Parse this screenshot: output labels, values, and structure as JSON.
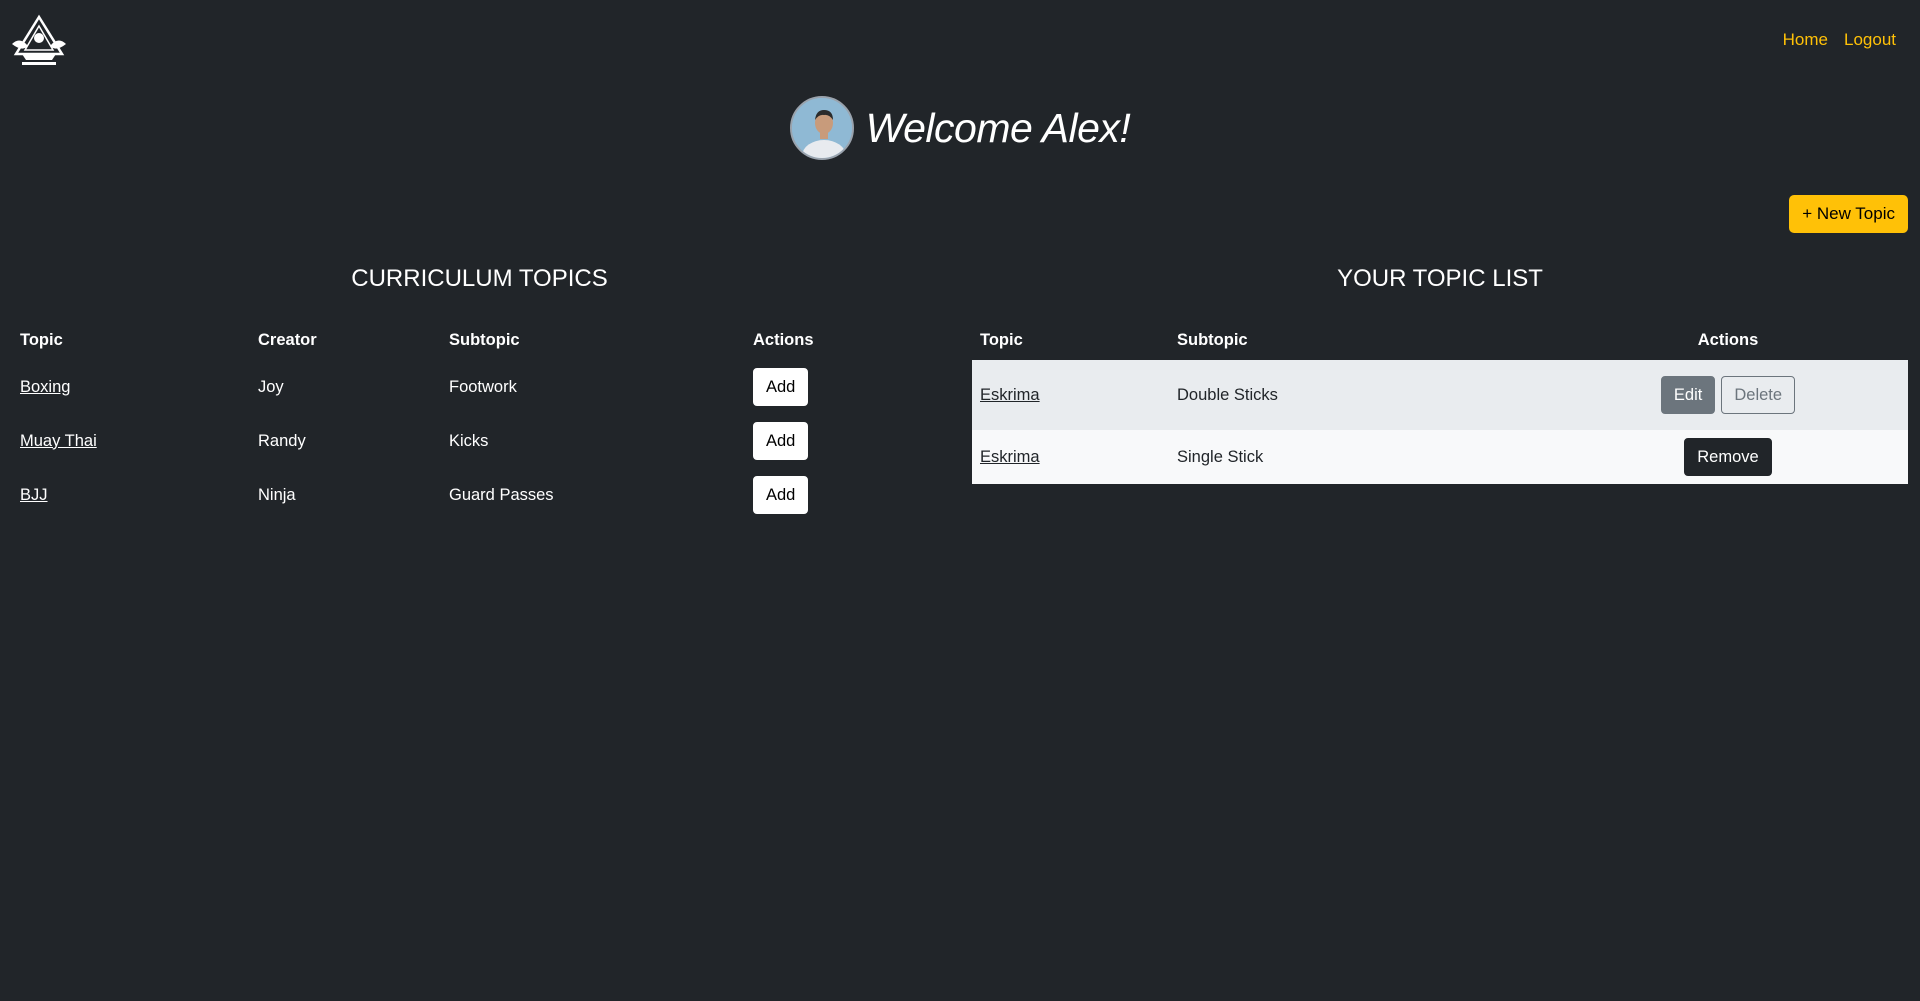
{
  "nav": {
    "home": "Home",
    "logout": "Logout"
  },
  "welcome": {
    "text": "Welcome Alex!"
  },
  "actions": {
    "new_topic": "+ New Topic"
  },
  "curriculum": {
    "title": "CURRICULUM TOPICS",
    "headers": [
      "Topic",
      "Creator",
      "Subtopic",
      "Actions"
    ],
    "rows": [
      {
        "topic": "Boxing",
        "creator": "Joy",
        "subtopic": "Footwork",
        "action": "Add"
      },
      {
        "topic": "Muay Thai",
        "creator": "Randy",
        "subtopic": "Kicks",
        "action": "Add"
      },
      {
        "topic": "BJJ",
        "creator": "Ninja",
        "subtopic": "Guard Passes",
        "action": "Add"
      }
    ]
  },
  "your_list": {
    "title": "YOUR TOPIC LIST",
    "headers": [
      "Topic",
      "Subtopic",
      "Actions"
    ],
    "rows": [
      {
        "topic": "Eskrima",
        "subtopic": "Double Sticks",
        "edit": "Edit",
        "delete": "Delete"
      },
      {
        "topic": "Eskrima",
        "subtopic": "Single Stick",
        "remove": "Remove"
      }
    ]
  },
  "colors": {
    "background": "#212529",
    "accent": "#ffc107",
    "row_alt_1": "#e9ecef",
    "row_alt_2": "#f8f9fa"
  },
  "icons": {
    "logo": "martial-arts-logo-icon",
    "avatar": "user-avatar"
  }
}
